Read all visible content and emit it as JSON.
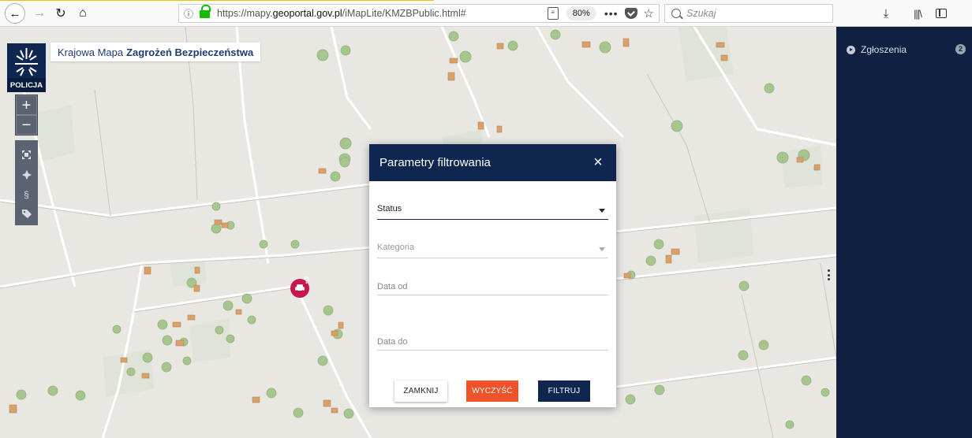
{
  "browser": {
    "url_prefix": "https://mapy.",
    "url_domain": "geoportal.gov.pl",
    "url_path": "/iMapLite/KMZBPublic.html#",
    "zoom": "80%",
    "page_actions": "•••",
    "search_placeholder": "Szukaj"
  },
  "app": {
    "logo_text": "POLICJA",
    "title_normal": "Krajowa Mapa",
    "title_bold": "Zagrożeń Bezpieczeństwa",
    "zoom_in": "+",
    "zoom_out": "−"
  },
  "tools": [
    "⌖",
    "⌖",
    "§",
    "◊"
  ],
  "panel": {
    "title": "Zgłoszenia",
    "count": "2"
  },
  "modal": {
    "title": "Parametry filtrowania",
    "close": "×",
    "fields": {
      "status": "Status",
      "kategoria": "Kategoria",
      "data_od": "Data od",
      "data_do": "Data do"
    },
    "buttons": {
      "close": "ZAMKNIJ",
      "clear": "WYCZYŚĆ",
      "filter": "FILTRUJ"
    }
  },
  "colors": {
    "brand_navy": "#0f2651",
    "clear_orange": "#f0532a",
    "marker_red": "#c8174a"
  }
}
